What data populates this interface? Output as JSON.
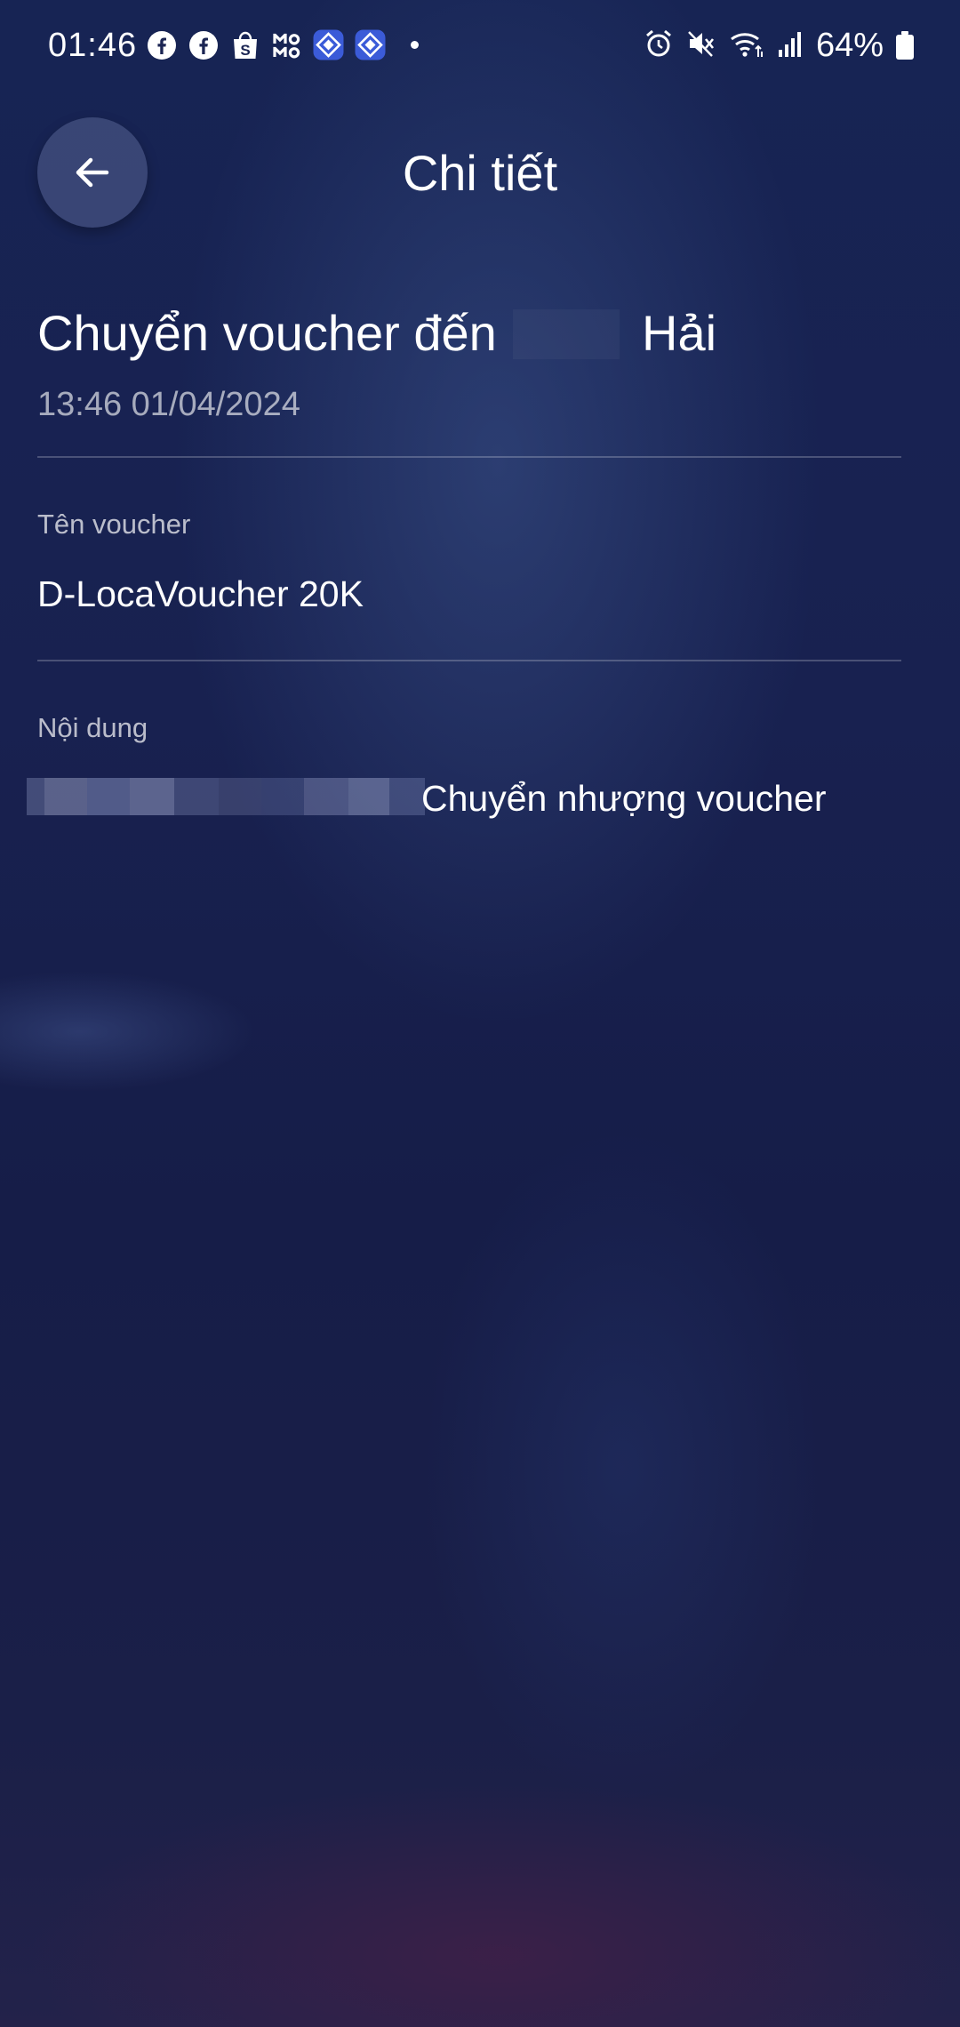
{
  "status_bar": {
    "time": "01:46",
    "battery_percent": "64%",
    "notification_icons": [
      "facebook-icon",
      "facebook-icon",
      "shopee-icon",
      "momo-icon",
      "app-diamond-icon",
      "app-diamond-icon"
    ],
    "system_icons": [
      "alarm-icon",
      "mute-icon",
      "wifi-icon",
      "signal-icon",
      "battery-icon"
    ]
  },
  "header": {
    "title": "Chi tiết",
    "back_icon": "arrow-left-icon"
  },
  "transfer": {
    "title_prefix": "Chuyển voucher đến",
    "recipient_suffix": "Hải",
    "timestamp": "13:46 01/04/2024"
  },
  "voucher": {
    "label": "Tên voucher",
    "value": "D-LocaVoucher 20K"
  },
  "note": {
    "label": "Nội dung",
    "value": "Chuyển nhượng voucher"
  },
  "colors": {
    "background_top": "#172454",
    "background_bottom": "#23224a",
    "text_primary": "#ffffff"
  }
}
